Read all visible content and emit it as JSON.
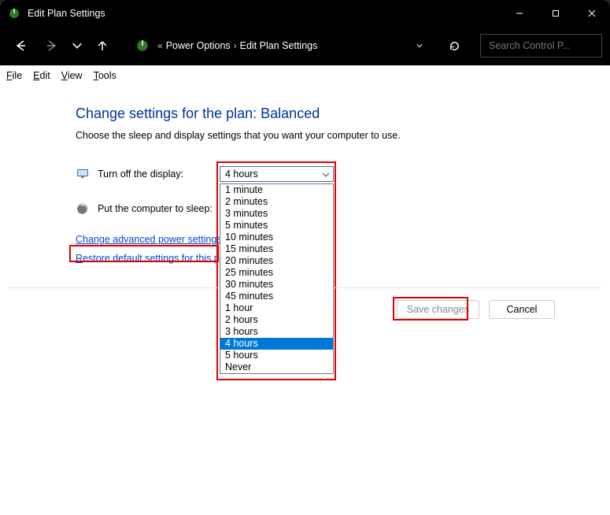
{
  "title": "Edit Plan Settings",
  "breadcrumb": {
    "seg1": "Power Options",
    "seg2": "Edit Plan Settings"
  },
  "search": {
    "placeholder": "Search Control P..."
  },
  "menu": {
    "file": "File",
    "edit": "Edit",
    "view": "View",
    "tools": "Tools"
  },
  "heading": "Change settings for the plan: Balanced",
  "subtext": "Choose the sleep and display settings that you want your computer to use.",
  "row1": {
    "label": "Turn off the display:",
    "value": "4 hours"
  },
  "row2": {
    "label": "Put the computer to sleep:"
  },
  "link_adv": "Change advanced power settings",
  "link_restore": "Restore default settings for this plan",
  "buttons": {
    "save": "Save changes",
    "cancel": "Cancel"
  },
  "options": [
    "1 minute",
    "2 minutes",
    "3 minutes",
    "5 minutes",
    "10 minutes",
    "15 minutes",
    "20 minutes",
    "25 minutes",
    "30 minutes",
    "45 minutes",
    "1 hour",
    "2 hours",
    "3 hours",
    "4 hours",
    "5 hours",
    "Never"
  ],
  "selected_index": 13
}
